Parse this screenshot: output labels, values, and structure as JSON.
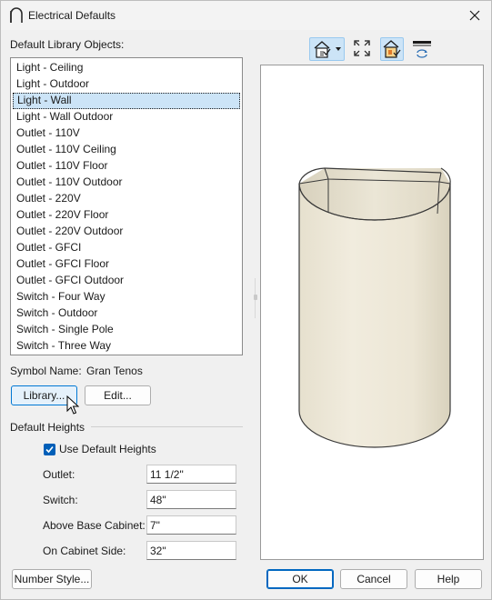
{
  "window": {
    "title": "Electrical Defaults",
    "app_icon": "chief-architect-arch-icon",
    "close_icon": "close-icon"
  },
  "library": {
    "label": "Default Library Objects:",
    "items": [
      "Light - Ceiling",
      "Light - Outdoor",
      "Light - Wall",
      "Light - Wall Outdoor",
      "Outlet - 110V",
      "Outlet - 110V Ceiling",
      "Outlet - 110V Floor",
      "Outlet - 110V Outdoor",
      "Outlet - 220V",
      "Outlet - 220V Floor",
      "Outlet - 220V Outdoor",
      "Outlet - GFCI",
      "Outlet - GFCI Floor",
      "Outlet - GFCI Outdoor",
      "Switch - Four Way",
      "Switch - Outdoor",
      "Switch - Single Pole",
      "Switch - Three Way"
    ],
    "selected": "Light - Wall"
  },
  "symbol": {
    "label": "Symbol Name:",
    "value": "Gran Tenos"
  },
  "buttons": {
    "library": "Library...",
    "edit": "Edit...",
    "number_style": "Number Style...",
    "ok": "OK",
    "cancel": "Cancel",
    "help": "Help"
  },
  "heights": {
    "group_label": "Default Heights",
    "use_default_label": "Use Default Heights",
    "use_default_checked": true,
    "outlet_label": "Outlet:",
    "outlet_value": "11 1/2\"",
    "switch_label": "Switch:",
    "switch_value": "48\"",
    "above_base_label": "Above Base Cabinet:",
    "above_base_value": "7\"",
    "cabinet_side_label": "On Cabinet Side:",
    "cabinet_side_value": "32\""
  },
  "toolbar": {
    "buttons": [
      {
        "icon": "camera-view-dropdown-icon",
        "pressed": true
      },
      {
        "icon": "fill-window-icon",
        "pressed": false
      },
      {
        "icon": "color-toggle-icon",
        "pressed": true
      },
      {
        "icon": "rotate-view-icon",
        "pressed": false
      }
    ]
  },
  "preview": {
    "object": "half-cylinder-wall-light",
    "fill_color": "#efeadb",
    "outline_color": "#3a3a3a"
  }
}
